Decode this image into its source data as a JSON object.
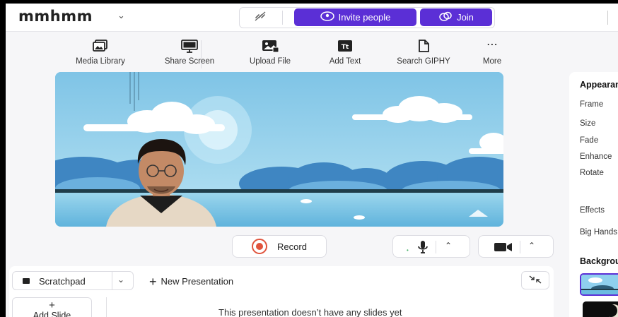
{
  "app": {
    "name": "mmhmm"
  },
  "topbar": {
    "invite_label": "Invite people",
    "join_label": "Join"
  },
  "toolbar": {
    "items": [
      {
        "label": "Media Library",
        "icon": "media-library-icon"
      },
      {
        "label": "Share Screen",
        "icon": "monitor-icon"
      },
      {
        "label": "Upload File",
        "icon": "upload-image-icon"
      },
      {
        "label": "Add Text",
        "icon": "text-icon"
      },
      {
        "label": "Search GIPHY",
        "icon": "document-icon"
      },
      {
        "label": "More",
        "icon": "more-dots-icon"
      }
    ]
  },
  "controls": {
    "record_label": "Record"
  },
  "presentation": {
    "selector_label": "Scratchpad",
    "new_presentation_label": "New Presentation",
    "add_slide_label": "Add Slide",
    "empty_message": "This presentation doesn’t have any slides yet"
  },
  "right_panel": {
    "appearance_title": "Appearance",
    "appearance_items": [
      "Frame",
      "Size",
      "Fade",
      "Enhance",
      "Rotate",
      "Effects",
      "Big Hands"
    ],
    "background_title": "Background"
  },
  "colors": {
    "accent": "#5b2fd6",
    "record": "#e0533c"
  }
}
